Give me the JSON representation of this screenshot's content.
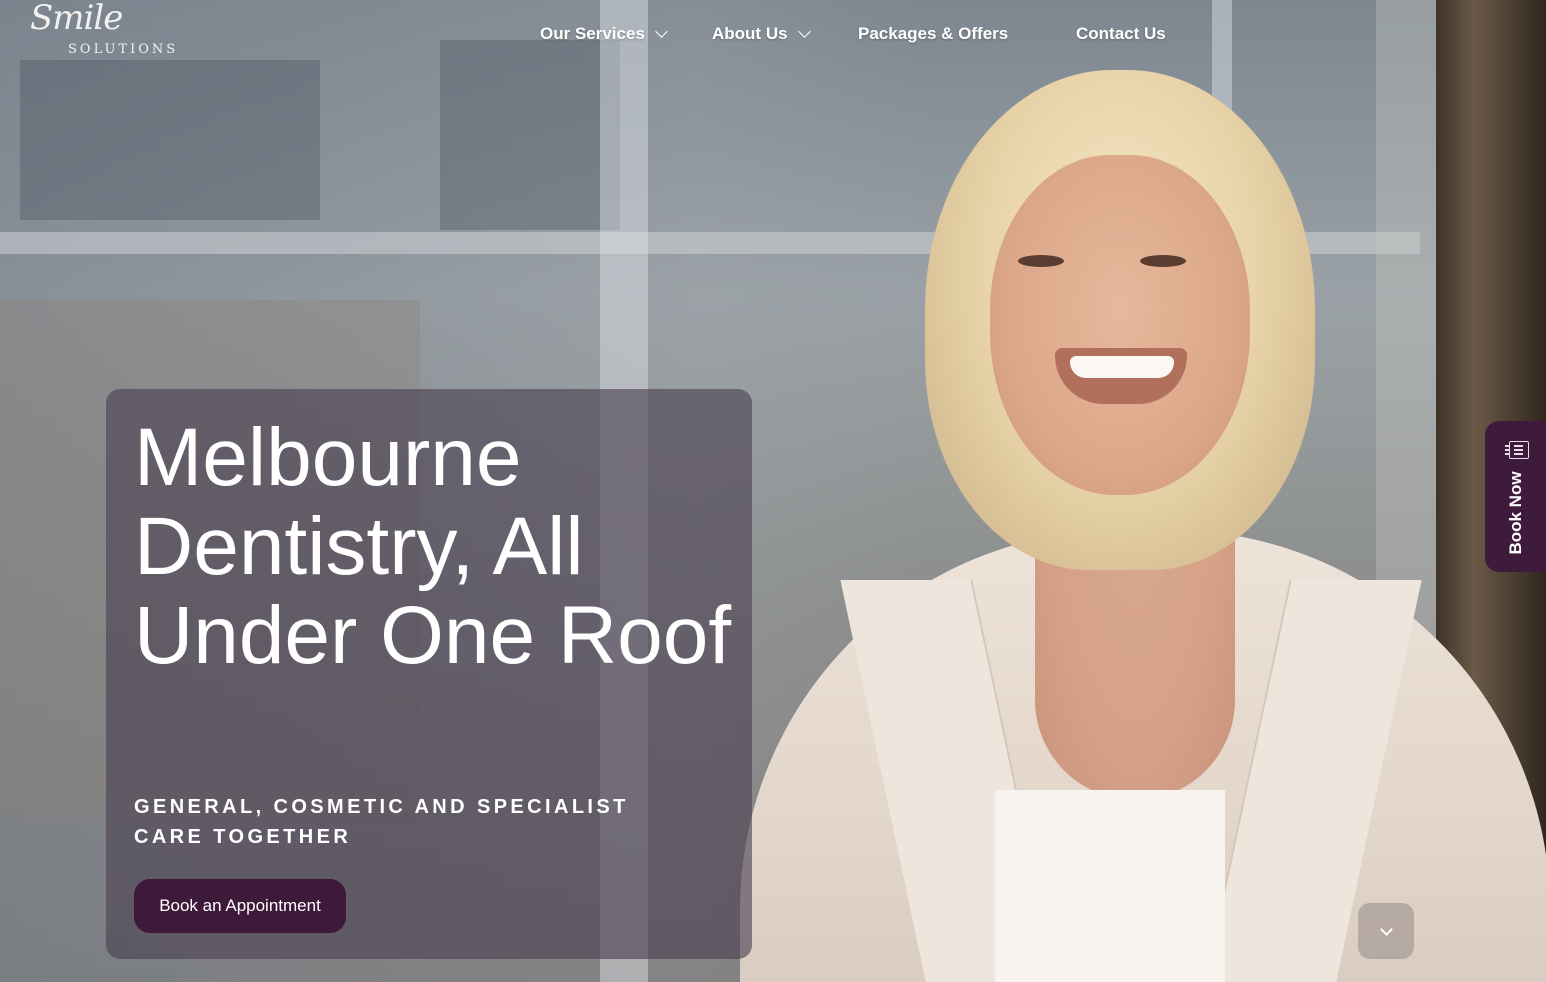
{
  "brand": {
    "logo_script": "Smile",
    "logo_sub": "SOLUTIONS"
  },
  "nav": {
    "items": [
      {
        "label": "Our Services",
        "has_dropdown": true
      },
      {
        "label": "About Us",
        "has_dropdown": true
      },
      {
        "label": "Packages & Offers",
        "has_dropdown": false
      },
      {
        "label": "Contact Us",
        "has_dropdown": false
      }
    ]
  },
  "hero": {
    "title": "Melbourne Dentistry, All Under One Roof",
    "subtitle": "GENERAL, COSMETIC AND SPECIALIST CARE TOGETHER",
    "cta_label": "Book an Appointment"
  },
  "side_tab": {
    "label": "Book Now",
    "icon": "calendar-book-icon"
  },
  "scroll_button": {
    "icon": "chevron-down-icon"
  },
  "colors": {
    "brand_plum": "#3e1a3b",
    "card_overlay": "#4a4052",
    "text": "#ffffff"
  }
}
